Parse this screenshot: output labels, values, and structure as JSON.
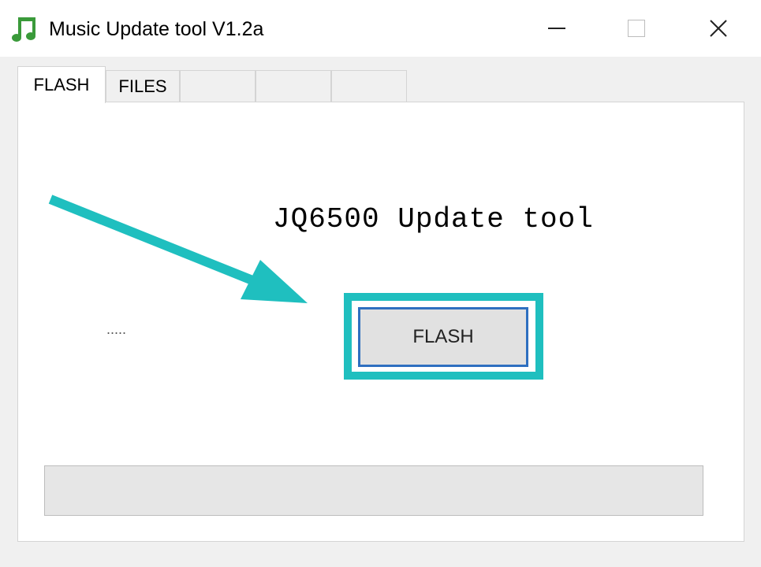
{
  "window": {
    "title": "Music Update tool V1.2a",
    "icon": "music-note-icon",
    "controls": {
      "minimize_icon": "minimize-icon",
      "maximize_icon": "maximize-icon",
      "close_icon": "close-icon"
    }
  },
  "tabs": [
    {
      "label": "FLASH",
      "active": true
    },
    {
      "label": "FILES",
      "active": false
    },
    {
      "label": "",
      "active": false
    },
    {
      "label": "",
      "active": false
    },
    {
      "label": "",
      "active": false
    }
  ],
  "main": {
    "heading": "JQ6500 Update tool",
    "status_dots": ".....",
    "flash_button_label": "FLASH"
  },
  "progress": {
    "value": 0
  },
  "annotation": {
    "arrow_color": "#1fbfbf",
    "highlight_color": "#1fbfbf"
  },
  "colors": {
    "accent": "#1fbfbf",
    "button_border": "#2e6fc0"
  }
}
